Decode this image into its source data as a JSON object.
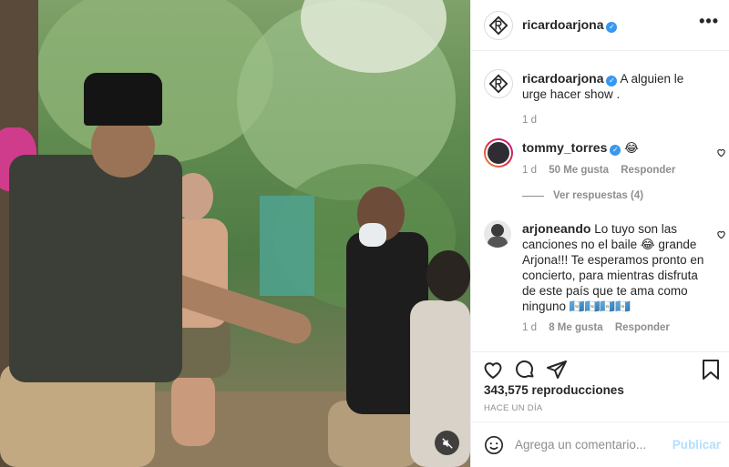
{
  "post": {
    "author": "ricardoarjona",
    "verified_mark": "✓",
    "more_label": "•••",
    "caption_user": "ricardoarjona",
    "caption_text": "A alguien le urge hacer show .",
    "caption_time": "1 d"
  },
  "comments": [
    {
      "user": "tommy_torres",
      "text": "😂",
      "time": "1 d",
      "likes": "50 Me gusta",
      "reply": "Responder",
      "view_replies": "Ver respuestas (4)"
    },
    {
      "user": "arjoneando",
      "text": "Lo tuyo son las canciones no el baile 😂 grande Arjona!!! Te esperamos pronto en concierto, para mientras disfruta de este país que te ama como ninguno 🇬🇹🇬🇹🇬🇹🇬🇹",
      "time": "1 d",
      "likes": "8 Me gusta",
      "reply": "Responder"
    }
  ],
  "stats": {
    "views": "343,575 reproducciones",
    "posted": "HACE UN DÍA"
  },
  "composer": {
    "placeholder": "Agrega un comentario...",
    "post_label": "Publicar"
  },
  "icons": {
    "like": "heart-icon",
    "comment": "comment-icon",
    "share": "share-icon",
    "save": "bookmark-icon",
    "emoji": "emoji-icon",
    "mute": "mute-icon"
  },
  "colors": {
    "verified": "#3897f0",
    "post_disabled": "#b2dffc",
    "muted_text": "#8e8e8e"
  }
}
